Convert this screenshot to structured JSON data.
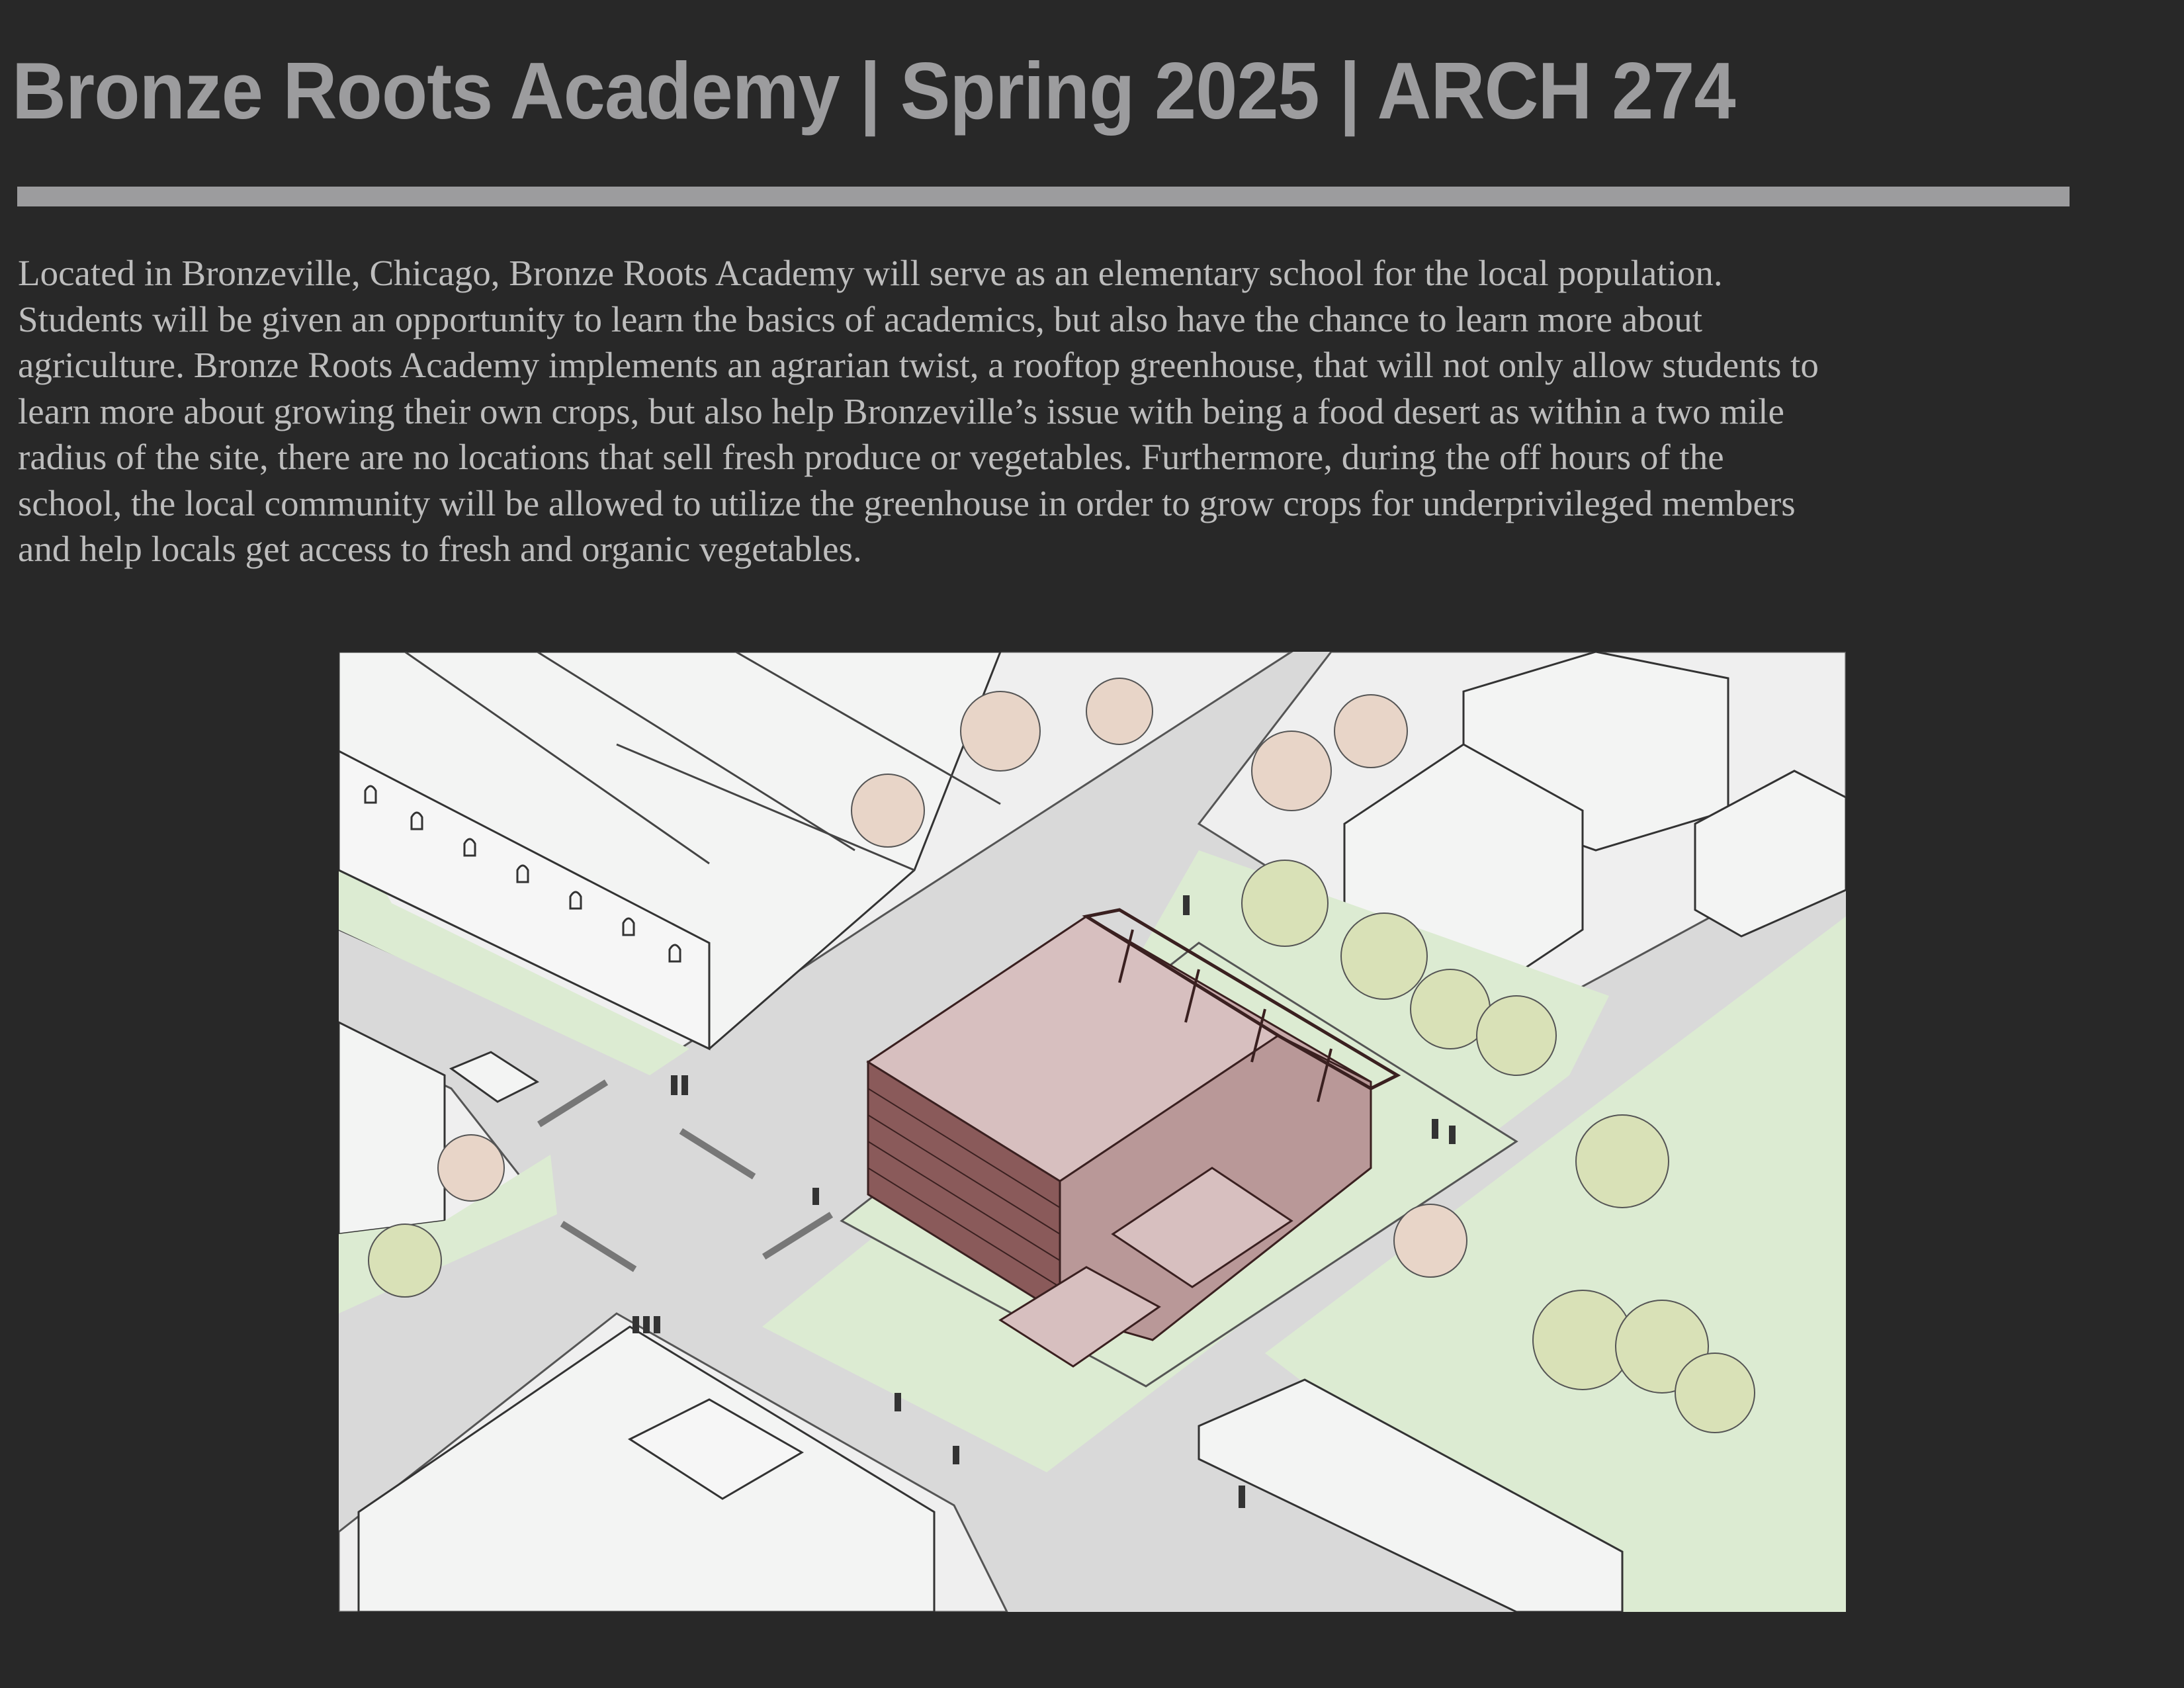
{
  "header": {
    "title": "Bronze Roots Academy | Spring 2025 | ARCH 274"
  },
  "description": {
    "lines": [
      "Located in Bronzeville, Chicago, Bronze Roots Academy will serve as an elementary school for the local population.",
      "Students will be given an opportunity to learn the basics of academics, but also have the chance to learn more about",
      "agriculture. Bronze Roots Academy implements an agrarian twist, a rooftop greenhouse, that will not only allow students to",
      "learn more about growing their own crops, but also help Bronzeville’s issue with being a food desert as within a two mile",
      "radius of the site, there are no locations that sell fresh produce or vegetables. Furthermore, during the off hours of the",
      "school, the local community will be allowed to utilize the greenhouse in order to grow crops for underprivileged members",
      "and help locals get access to fresh and organic vegetables."
    ]
  },
  "colors": {
    "background": "#282828",
    "title": "#9c9c9e",
    "body_text": "#bdbdbd",
    "school_building": "#d7bfbf",
    "school_facade": "#8a5a5a",
    "lawn": "#dcebd2",
    "street": "#d9d9d9",
    "sidewalk": "#efefef",
    "building": "#f3f4f3"
  },
  "figure": {
    "icon": "axonometric-site-drawing"
  }
}
